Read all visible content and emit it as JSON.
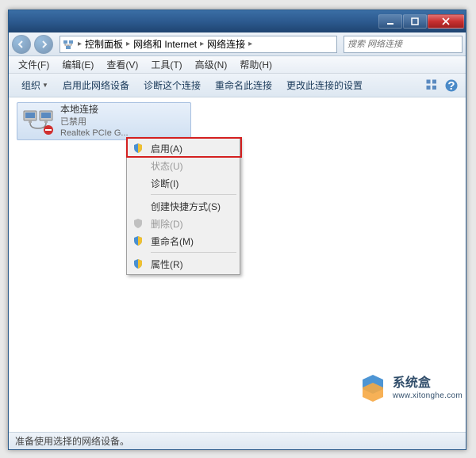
{
  "breadcrumb": {
    "items": [
      "控制面板",
      "网络和 Internet",
      "网络连接"
    ]
  },
  "search": {
    "placeholder": "搜索 网络连接"
  },
  "menubar": {
    "file": "文件(F)",
    "edit": "编辑(E)",
    "view": "查看(V)",
    "tools": "工具(T)",
    "advanced": "高级(N)",
    "help": "帮助(H)"
  },
  "toolbar": {
    "organize": "组织",
    "enable_device": "启用此网络设备",
    "diagnose": "诊断这个连接",
    "rename": "重命名此连接",
    "change_settings": "更改此连接的设置"
  },
  "connection": {
    "name": "本地连接",
    "status": "已禁用",
    "adapter": "Realtek PCIe G..."
  },
  "context_menu": {
    "enable": "启用(A)",
    "status": "状态(U)",
    "diagnose": "诊断(I)",
    "shortcut": "创建快捷方式(S)",
    "delete": "删除(D)",
    "rename": "重命名(M)",
    "properties": "属性(R)"
  },
  "statusbar": {
    "text": "准备使用选择的网络设备。"
  },
  "watermark": {
    "line1": "系统盒",
    "line2": "www.xitonghe.com"
  }
}
